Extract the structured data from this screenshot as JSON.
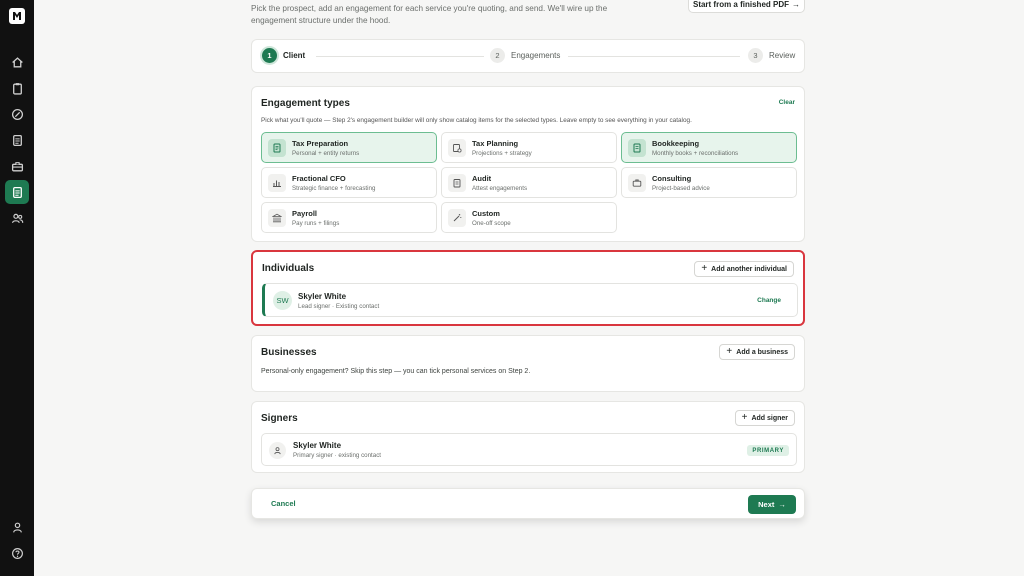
{
  "rail": {
    "icons": [
      "logo-icon",
      "home-icon",
      "clipboard-icon",
      "gauge-icon",
      "document-icon",
      "briefcase-icon",
      "proposals-icon",
      "people-icon",
      "user-icon",
      "help-icon"
    ],
    "accent": "#1e7a52"
  },
  "header": {
    "intro": "Pick the prospect, add an engagement for each service you're quoting, and send. We'll wire up the engagement structure under the hood.",
    "pdf_button": "Start from a finished PDF",
    "pdf_arrow": "→"
  },
  "stepper": {
    "steps": [
      {
        "num": "1",
        "label": "Client"
      },
      {
        "num": "2",
        "label": "Engagements"
      },
      {
        "num": "3",
        "label": "Review"
      }
    ]
  },
  "engagement_types": {
    "title": "Engagement types",
    "clear": "Clear",
    "description": "Pick what you'll quote — Step 2's engagement builder will only show catalog items for the selected types. Leave empty to see everything in your catalog.",
    "tiles": [
      {
        "title": "Tax Preparation",
        "subtitle": "Personal + entity returns",
        "icon": "tax-form-icon",
        "selected": true
      },
      {
        "title": "Tax Planning",
        "subtitle": "Projections + strategy",
        "icon": "planning-icon",
        "selected": false
      },
      {
        "title": "Bookkeeping",
        "subtitle": "Monthly books + reconciliations",
        "icon": "ledger-icon",
        "selected": true
      },
      {
        "title": "Fractional CFO",
        "subtitle": "Strategic finance + forecasting",
        "icon": "bar-chart-icon",
        "selected": false
      },
      {
        "title": "Audit",
        "subtitle": "Attest engagements",
        "icon": "checklist-icon",
        "selected": false
      },
      {
        "title": "Consulting",
        "subtitle": "Project-based advice",
        "icon": "briefcase-icon",
        "selected": false
      },
      {
        "title": "Payroll",
        "subtitle": "Pay runs + filings",
        "icon": "bank-icon",
        "selected": false
      },
      {
        "title": "Custom",
        "subtitle": "One-off scope",
        "icon": "wand-icon",
        "selected": false
      }
    ]
  },
  "individuals": {
    "title": "Individuals",
    "add_button": "Add another individual",
    "contact": {
      "initials": "SW",
      "name": "Skyler White",
      "subtitle": "Lead signer · Existing contact",
      "change": "Change"
    }
  },
  "businesses": {
    "title": "Businesses",
    "add_button": "Add a business",
    "note": "Personal-only engagement? Skip this step — you can tick personal services on Step 2."
  },
  "signers": {
    "title": "Signers",
    "add_button": "Add signer",
    "signer": {
      "name": "Skyler White",
      "subtitle": "Primary signer · existing contact",
      "badge": "PRIMARY"
    }
  },
  "footer": {
    "cancel": "Cancel",
    "next": "Next",
    "next_arrow": "→"
  },
  "colors": {
    "accent": "#1e7a52",
    "selected_bg": "#e7f4ec",
    "highlight_border": "#d9363e"
  }
}
